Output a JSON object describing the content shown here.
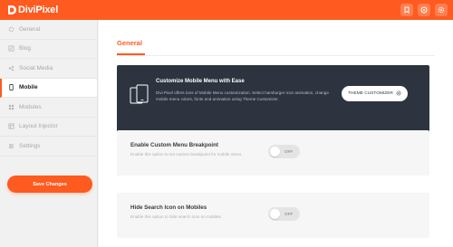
{
  "app": {
    "logo_text": "DiviPixel",
    "accent_color": "#ff5a1f"
  },
  "header": {
    "icons": [
      "bookmark-icon",
      "help-icon",
      "gear-icon"
    ]
  },
  "sidebar": {
    "items": [
      {
        "label": "General",
        "icon": "gear-icon",
        "active": false
      },
      {
        "label": "Blog",
        "icon": "edit-icon",
        "active": false
      },
      {
        "label": "Social Media",
        "icon": "share-icon",
        "active": false
      },
      {
        "label": "Mobile",
        "icon": "mobile-icon",
        "active": true
      },
      {
        "label": "Modules",
        "icon": "grid-icon",
        "active": false
      },
      {
        "label": "Layout Injector",
        "icon": "layout-icon",
        "active": false
      },
      {
        "label": "Settings",
        "icon": "sliders-icon",
        "active": false
      }
    ],
    "save_label": "Save Changes"
  },
  "main": {
    "section_title": "General",
    "promo": {
      "title": "Customize Mobile Menu with Ease",
      "description": "Divi Pixel offers tons of Mobile Menu customization. Select hamburger icon animation, change mobile menu colors, fonts and animation using Theme Customizer.",
      "button_label": "THEME CUSTOMIZER",
      "background_color": "#2d3440"
    },
    "settings": [
      {
        "title": "Enable Custom Menu Breakpoint",
        "description": "Enable this option to set custom breakpoint for mobile menu.",
        "toggle_label": "OFF",
        "enabled": false
      },
      {
        "title": "Hide Search Icon on Mobiles",
        "description": "Enable this option to hide search icon on mobiles.",
        "toggle_label": "OFF",
        "enabled": false
      }
    ]
  }
}
